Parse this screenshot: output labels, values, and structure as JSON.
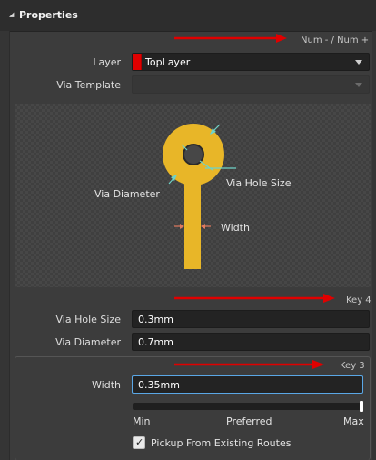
{
  "panel": {
    "title": "Properties"
  },
  "hints": {
    "layer_shortcut": "Num - / Num +",
    "via_key": "Key 4",
    "width_key": "Key 3"
  },
  "layer": {
    "label": "Layer",
    "value": "TopLayer",
    "swatch_color": "#e00000"
  },
  "via_template": {
    "label": "Via Template",
    "value": ""
  },
  "diagram": {
    "via_diameter_label": "Via Diameter",
    "via_hole_size_label": "Via Hole Size",
    "width_label": "Width"
  },
  "fields": {
    "via_hole_size": {
      "label": "Via Hole Size",
      "value": "0.3mm"
    },
    "via_diameter": {
      "label": "Via Diameter",
      "value": "0.7mm"
    },
    "width": {
      "label": "Width",
      "value": "0.35mm"
    }
  },
  "slider": {
    "min_label": "Min",
    "mid_label": "Preferred",
    "max_label": "Max",
    "level": 1.0
  },
  "pickup": {
    "label": "Pickup From Existing Routes",
    "checked": true
  },
  "colors": {
    "annotation_arrow": "#e00000",
    "via_copper": "#e8b628",
    "dimension_cyan": "#6fd3c8",
    "width_marker": "#e07a5f"
  }
}
